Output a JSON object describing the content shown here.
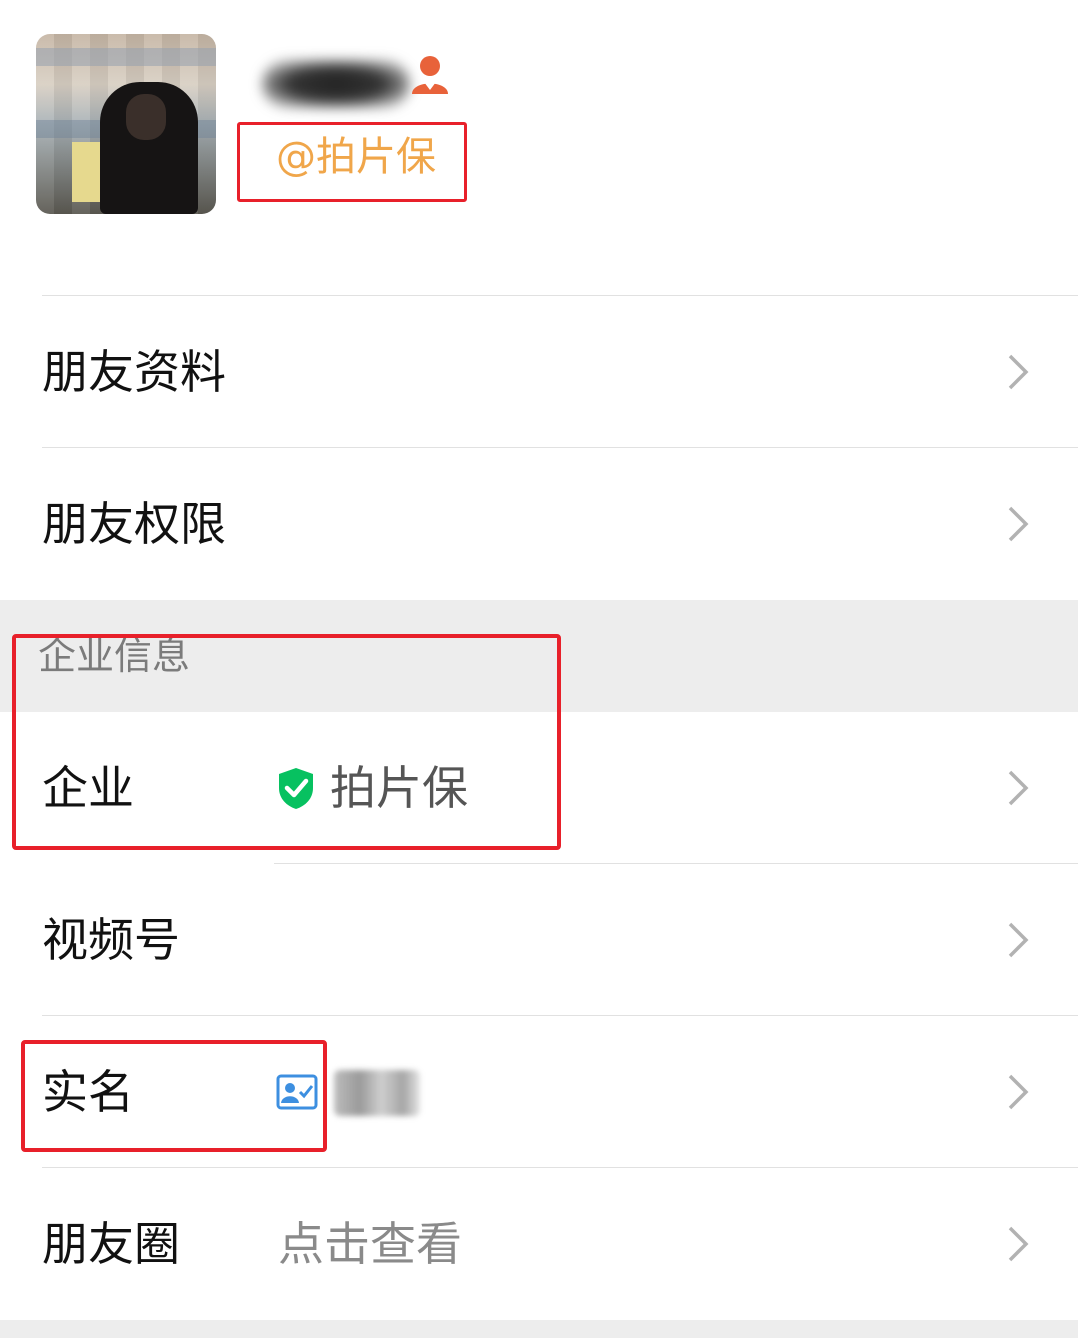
{
  "profile": {
    "avatar": "avatar-photo",
    "contact_icon": "person-icon",
    "corp_tag": "@拍片保"
  },
  "rows": {
    "friend_info": {
      "label": "朋友资料",
      "icon": "chevron-right-icon"
    },
    "friend_permissions": {
      "label": "朋友权限",
      "icon": "chevron-right-icon"
    }
  },
  "section": {
    "title": "企业信息"
  },
  "enterprise": {
    "label": "企业",
    "value": "拍片保",
    "icon": "verified-shield-icon",
    "icon_color": "#07c160"
  },
  "channels": {
    "label": "视频号"
  },
  "realname": {
    "label": "实名",
    "icon": "id-card-icon",
    "icon_color": "#3d8fe0"
  },
  "moments": {
    "label": "朋友圈",
    "value": "点击查看"
  },
  "colors": {
    "highlight": "#e8202a",
    "tag": "#f0a64a",
    "section_bg": "#ededed"
  }
}
